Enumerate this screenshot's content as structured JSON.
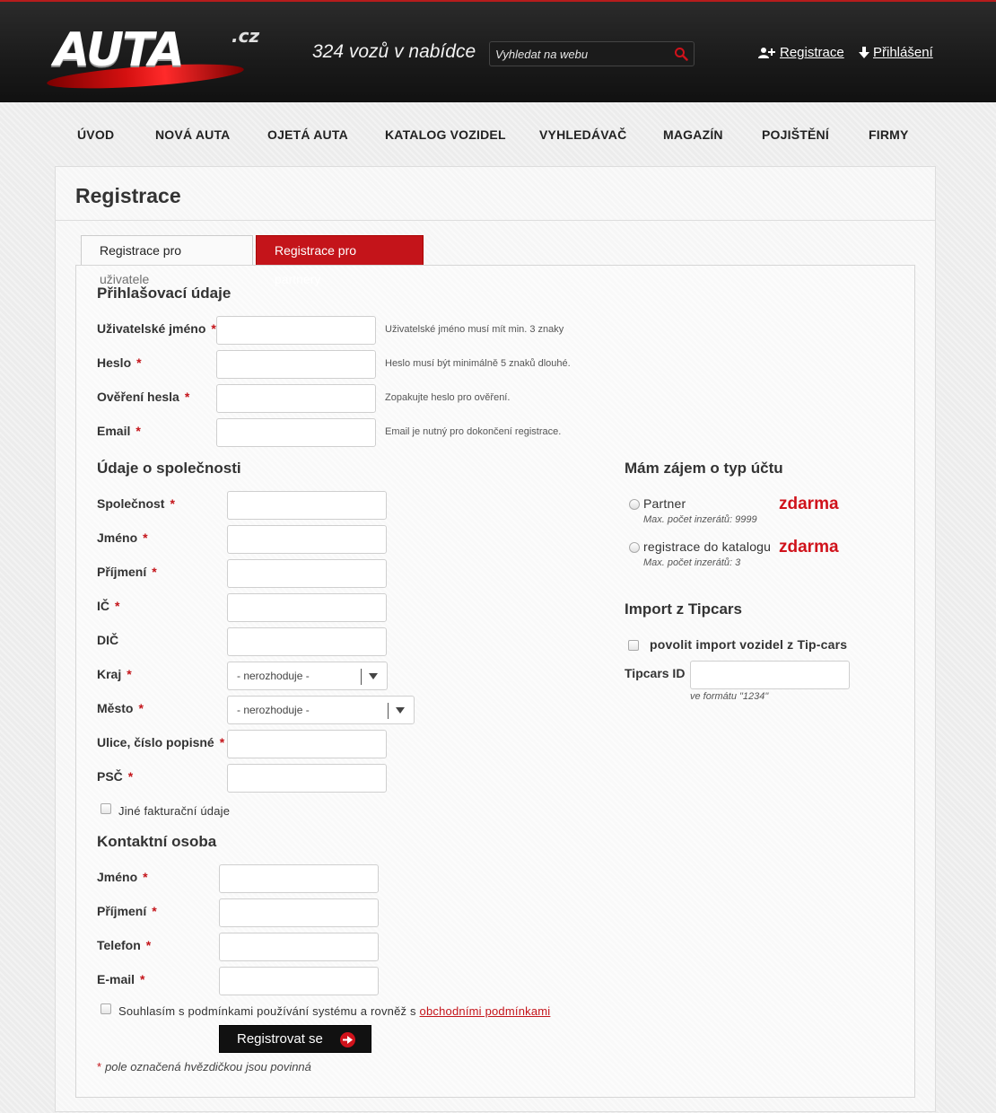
{
  "header": {
    "logo_word": "AUTA",
    "logo_suffix": ".cz",
    "tagline": "324 vozů v nabídce",
    "search_placeholder": "Vyhledat na webu",
    "register_link": "Registrace",
    "login_link": "Přihlášení"
  },
  "nav": [
    "ÚVOD",
    "NOVÁ AUTA",
    "OJETÁ AUTA",
    "KATALOG VOZIDEL",
    "VYHLEDÁVAČ",
    "MAGAZÍN",
    "POJIŠTĚNÍ",
    "FIRMY"
  ],
  "page": {
    "title": "Registrace",
    "tab_user": "Registrace pro uživatele",
    "tab_partner": "Registrace pro partnery"
  },
  "login_section": {
    "title": "Přihlašovací údaje",
    "username_label": "Uživatelské jméno",
    "username_hint": "Uživatelské jméno musí mít min. 3 znaky",
    "password_label": "Heslo",
    "password_hint": "Heslo musí být minimálně 5 znaků dlouhé.",
    "password_confirm_label": "Ověření hesla",
    "password_confirm_hint": "Zopakujte heslo pro ověření.",
    "email_label": "Email",
    "email_hint": "Email je nutný pro dokončení registrace."
  },
  "company_section": {
    "title": "Údaje o společnosti",
    "company_label": "Společnost",
    "first_name_label": "Jméno",
    "last_name_label": "Příjmení",
    "ic_label": "IČ",
    "dic_label": "DIČ",
    "region_label": "Kraj",
    "region_value": "- nerozhoduje -",
    "city_label": "Město",
    "city_value": "- nerozhoduje -",
    "street_label": "Ulice, číslo popisné",
    "zip_label": "PSČ",
    "other_billing_label": "Jiné fakturační údaje"
  },
  "account_type": {
    "title": "Mám zájem o typ účtu",
    "options": [
      {
        "label": "Partner",
        "note": "Max. počet inzerátů: 9999",
        "price": "zdarma"
      },
      {
        "label": "registrace do katalogu",
        "note": "Max. počet inzerátů: 3",
        "price": "zdarma"
      }
    ]
  },
  "tipcars": {
    "title": "Import z Tipcars",
    "allow_label": "povolit import vozidel z Tip-cars",
    "id_label": "Tipcars ID",
    "id_hint": "ve formátu \"1234\""
  },
  "contact_section": {
    "title": "Kontaktní osoba",
    "first_name_label": "Jméno",
    "last_name_label": "Příjmení",
    "phone_label": "Telefon",
    "email_label": "E-mail"
  },
  "terms": {
    "text": "Souhlasím s podmínkami používání systému a rovněž s ",
    "link": "obchodními podmínkami"
  },
  "submit_label": "Registrovat se",
  "required_marker": "*",
  "footnote": "pole označená hvězdičkou jsou povinná"
}
